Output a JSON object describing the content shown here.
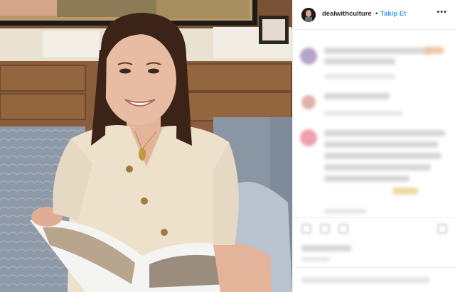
{
  "post": {
    "username": "dealwithculture",
    "separator": "•",
    "follow_label": "Takip Et",
    "more_label": "•••"
  },
  "colors": {
    "accent": "#3897f0",
    "text": "#262626",
    "border": "#efefef"
  },
  "icons": {
    "more": "more-options-icon",
    "like": "heart-icon",
    "comment": "comment-icon",
    "share": "share-icon",
    "save": "bookmark-icon"
  }
}
